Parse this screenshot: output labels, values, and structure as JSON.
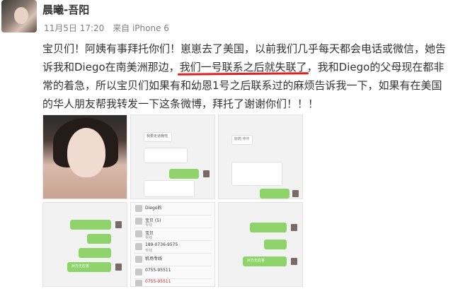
{
  "user": {
    "name": "晨曦-吾阳"
  },
  "meta": {
    "date": "11月5日",
    "time": "17:20",
    "source": "来自 iPhone 6"
  },
  "post": {
    "part1": "宝贝们！阿姨有事拜托你们！崽崽去了美国，以前我们几乎每天都会电话或微信，她告诉我和Diego在南美洲那边，",
    "highlight": "我们一号联系之后就失联了",
    "part2": "，我和Diego的父母现在都非常的着急，所以宝贝们如果有和幼恩1号之后联系过的麻烦告诉我一下，如果有在美国的华人朋友帮我转发一下这条微博，拜托了谢谢你们！！！"
  },
  "thumbs": {
    "t2": {
      "msg1": "我要走道晚啦"
    },
    "t3": {
      "msg1": "好的 中午"
    },
    "t5": {
      "bubble": "对方无应答"
    },
    "t6": {
      "rows": [
        {
          "title": "Diego的",
          "sub": ""
        },
        {
          "title": "宝贝 (5)",
          "sub": "专线"
        },
        {
          "title": "宝贝",
          "sub": "专线"
        },
        {
          "title": "189-0736-9575",
          "sub": "专线"
        },
        {
          "title": "机场专线",
          "sub": ""
        },
        {
          "title": "0755-95511",
          "sub": ""
        },
        {
          "title": "0755-95511",
          "sub": ""
        }
      ]
    },
    "t7": {
      "bubble": "对方无应答"
    }
  }
}
